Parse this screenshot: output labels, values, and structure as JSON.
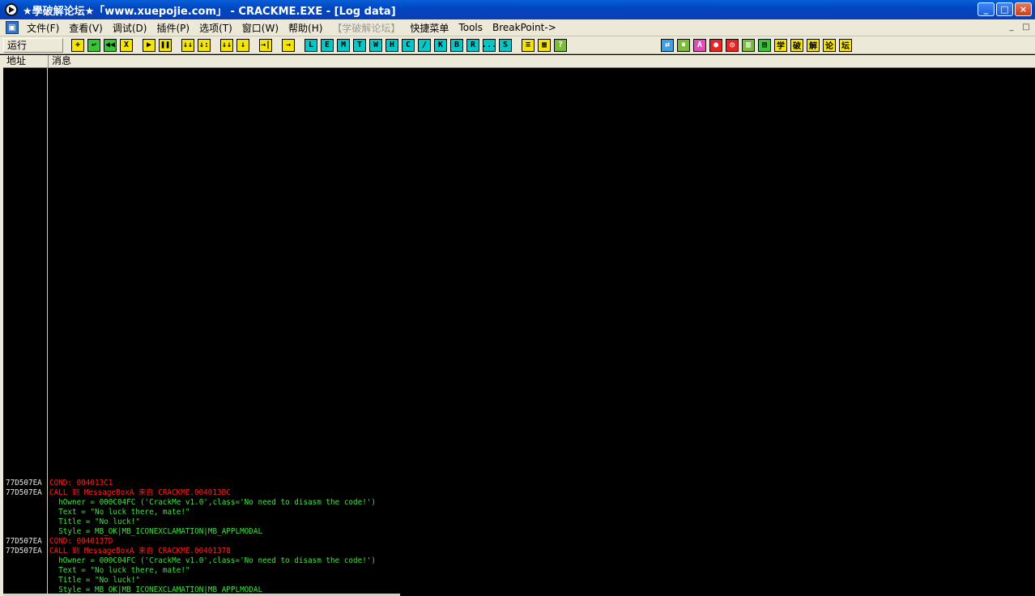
{
  "window": {
    "title": "★學破解论坛★「www.xuepojie.com」 - CRACKME.EXE - [Log data]",
    "buttons": [
      "_",
      "□",
      "×"
    ]
  },
  "menu": {
    "items": [
      "文件(F)",
      "查看(V)",
      "调试(D)",
      "插件(P)",
      "选项(T)",
      "窗口(W)",
      "帮助(H)",
      "【学破解论坛】",
      "快捷菜单",
      "Tools",
      "BreakPoint->"
    ],
    "mdi_buttons": [
      "_",
      "□"
    ]
  },
  "toolbar": {
    "status": "运行",
    "group1": [
      "+",
      "↩",
      "◀◀",
      "X"
    ],
    "group2": [
      "▶",
      "❚❚"
    ],
    "group3": [
      "↓↓",
      "↓:",
      "↓↓",
      "↓"
    ],
    "group4": [
      "→|"
    ],
    "group5": [
      "→"
    ],
    "letters": [
      "L",
      "E",
      "M",
      "T",
      "W",
      "H",
      "C",
      "/",
      "K",
      "B",
      "R",
      "...",
      "S"
    ],
    "group6": [
      "≡",
      "▦",
      "?"
    ],
    "right": [
      "⇄",
      "⏸",
      "A",
      "●",
      "◎",
      "▥",
      "▤",
      "学",
      "破",
      "解",
      "论",
      "坛"
    ]
  },
  "columns": {
    "address": "地址",
    "message": "消息"
  },
  "log": [
    {
      "addr": "77D507EA",
      "msg": "COND: 004013C1",
      "color": "red"
    },
    {
      "addr": "77D507EA",
      "msg": "CALL 到 MessageBoxA 来自 CRACKME.004013BC",
      "color": "red"
    },
    {
      "addr": "",
      "msg": "  hOwner = 000C04FC ('CrackMe v1.0',class='No need to disasm the code!')",
      "color": "green"
    },
    {
      "addr": "",
      "msg": "  Text = \"No luck there, mate!\"",
      "color": "green"
    },
    {
      "addr": "",
      "msg": "  Title = \"No luck!\"",
      "color": "green"
    },
    {
      "addr": "",
      "msg": "  Style = MB_OK|MB_ICONEXCLAMATION|MB_APPLMODAL",
      "color": "green"
    },
    {
      "addr": "77D507EA",
      "msg": "COND: 0040137D",
      "color": "red"
    },
    {
      "addr": "77D507EA",
      "msg": "CALL 到 MessageBoxA 来自 CRACKME.00401378",
      "color": "red"
    },
    {
      "addr": "",
      "msg": "  hOwner = 000C04FC ('CrackMe v1.0',class='No need to disasm the code!')",
      "color": "green"
    },
    {
      "addr": "",
      "msg": "  Text = \"No luck there, mate!\"",
      "color": "green"
    },
    {
      "addr": "",
      "msg": "  Title = \"No luck!\"",
      "color": "green"
    },
    {
      "addr": "",
      "msg": "  Style = MB_OK|MB_ICONEXCLAMATION|MB_APPLMODAL",
      "color": "green"
    }
  ]
}
